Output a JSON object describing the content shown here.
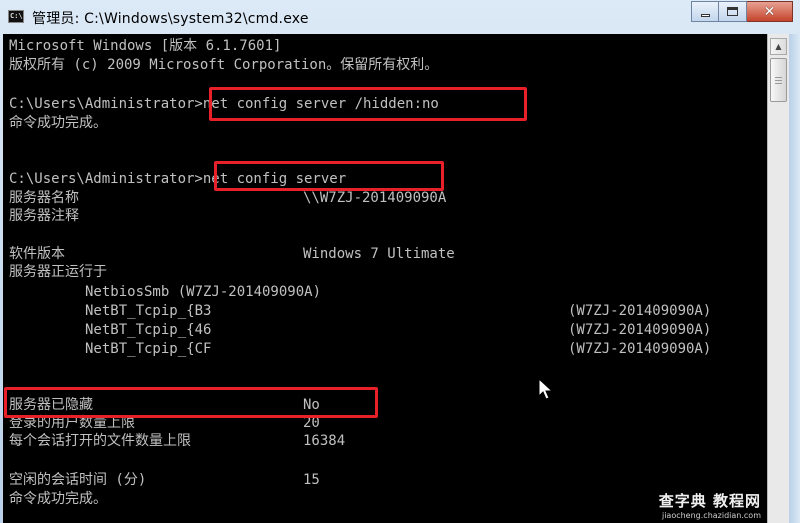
{
  "window": {
    "title": "管理员: C:\\Windows\\system32\\cmd.exe",
    "icon_label": "C:\\.",
    "buttons": {
      "minimize": "minimize-icon",
      "maximize": "maximize-icon",
      "close": "close-icon"
    }
  },
  "console": {
    "lines": [
      "Microsoft Windows [版本 6.1.7601]",
      "版权所有 (c) 2009 Microsoft Corporation。保留所有权利。",
      "C:\\Users\\Administrator>net config server /hidden:no",
      "命令成功完成。",
      "C:\\Users\\Administrator>net config server",
      "服务器名称",
      "服务器注释",
      "软件版本",
      "服务器正运行于",
      "NetbiosSmb (W7ZJ-201409090A)",
      "NetBT_Tcpip_{B3",
      "NetBT_Tcpip_{46",
      "NetBT_Tcpip_{CF",
      "服务器已隐藏",
      "登录的用户数量上限",
      "每个会话打开的文件数量上限",
      "空闲的会话时间 (分)",
      "命令成功完成。"
    ],
    "values": {
      "server_name": "\\\\W7ZJ-201409090A",
      "software_version": "Windows 7 Ultimate",
      "transport_1": "(W7ZJ-201409090A)",
      "transport_2": "(W7ZJ-201409090A)",
      "transport_3": "(W7ZJ-201409090A)",
      "hidden": "No",
      "max_users": "20",
      "max_open_files": "16384",
      "idle_time": "15"
    }
  },
  "colors": {
    "highlight": "#e8202a",
    "console_bg": "#000000",
    "console_text": "#c0c0c0"
  },
  "watermark": {
    "main": "查字典 教程网",
    "sub": "jiaocheng.chazidian.com"
  }
}
